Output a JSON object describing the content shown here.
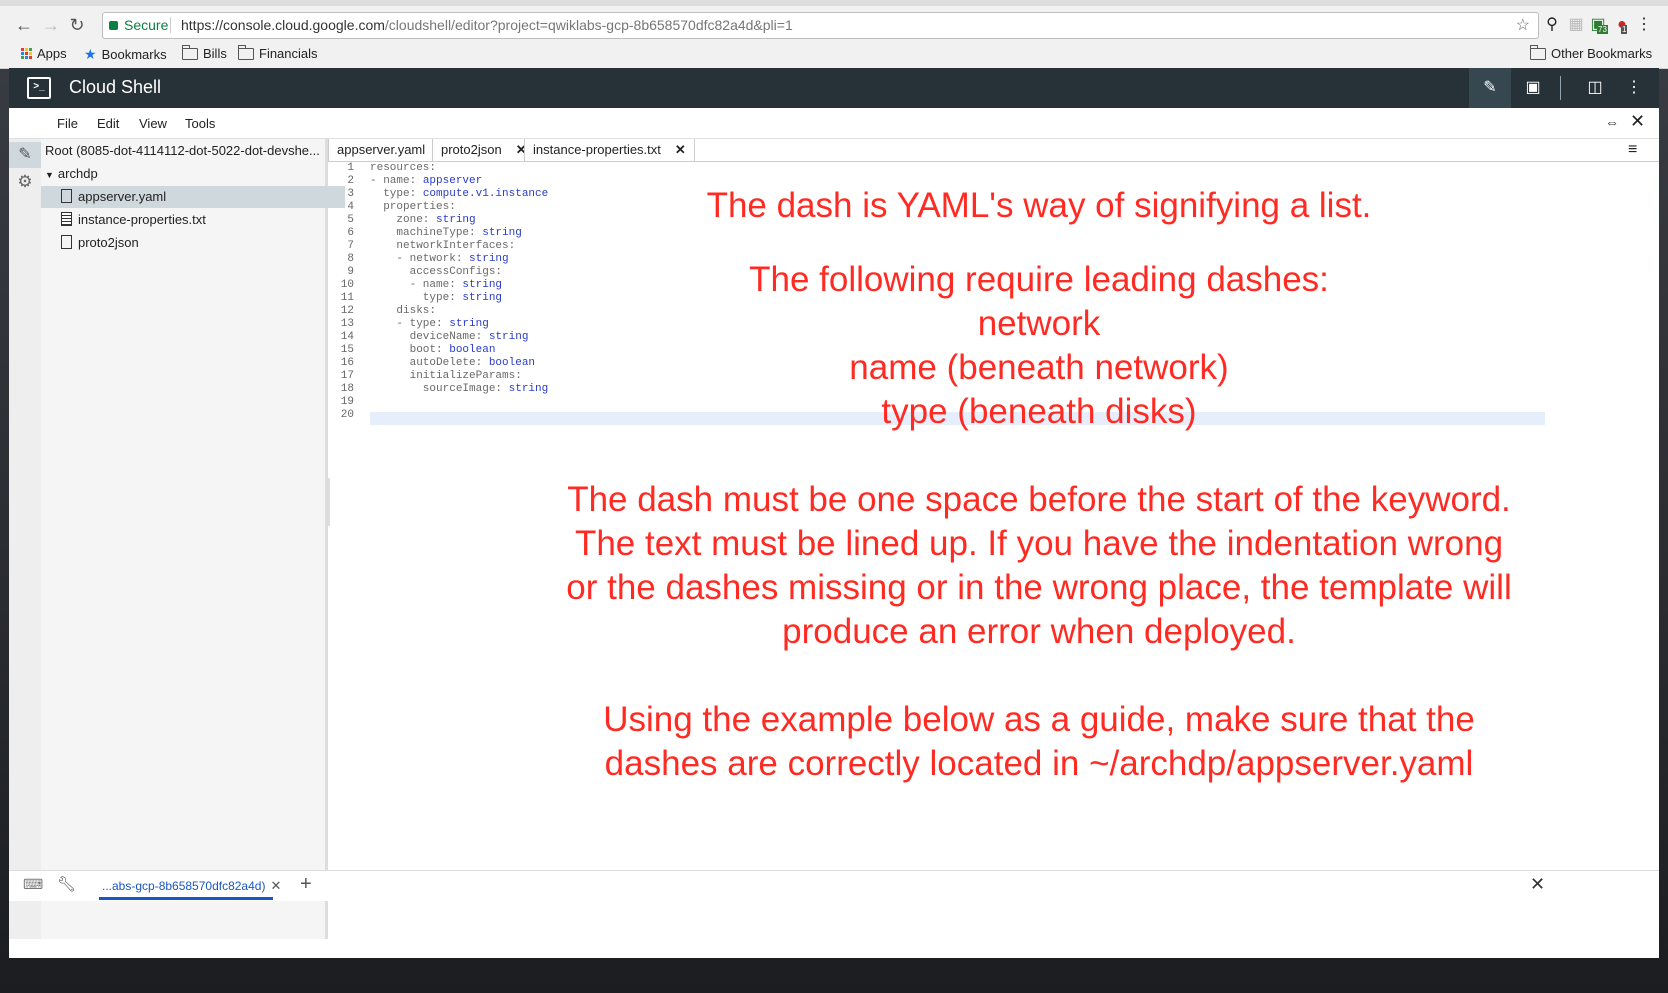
{
  "browser": {
    "secure_label": "Secure",
    "url_host": "https://console.cloud.google.com",
    "url_rest": "/cloudshell/editor?project=qwiklabs-gcp-8b658570dfc82a4d&pli=1",
    "ext_badge_1": "73",
    "ext_badge_2": "1",
    "bookmarks": [
      {
        "label": "Apps",
        "icon": "apps-grid-icon"
      },
      {
        "label": "Bookmarks",
        "icon": "star-icon"
      },
      {
        "label": "Bills",
        "icon": "folder-icon"
      },
      {
        "label": "Financials",
        "icon": "folder-icon"
      }
    ],
    "other_bookmarks": "Other Bookmarks"
  },
  "app": {
    "title": "Cloud Shell",
    "menu": [
      "File",
      "Edit",
      "View",
      "Tools"
    ]
  },
  "tree": {
    "root": "Root (8085-dot-4114112-dot-5022-dot-devshe...",
    "folder": "archdp",
    "files": [
      "appserver.yaml",
      "instance-properties.txt",
      "proto2json"
    ],
    "selected": "appserver.yaml"
  },
  "editor": {
    "tabs": [
      "appserver.yaml",
      "proto2json",
      "instance-properties.txt"
    ],
    "lines": [
      {
        "n": "1",
        "k": "resources:",
        "v": ""
      },
      {
        "n": "2",
        "k": "- name: ",
        "v": "appserver"
      },
      {
        "n": "3",
        "k": "  type: ",
        "v": "compute.v1.instance"
      },
      {
        "n": "4",
        "k": "  properties:",
        "v": ""
      },
      {
        "n": "5",
        "k": "    zone: ",
        "v": "string"
      },
      {
        "n": "6",
        "k": "    machineType: ",
        "v": "string"
      },
      {
        "n": "7",
        "k": "    networkInterfaces:",
        "v": ""
      },
      {
        "n": "8",
        "k": "    - network: ",
        "v": "string"
      },
      {
        "n": "9",
        "k": "      accessConfigs:",
        "v": ""
      },
      {
        "n": "10",
        "k": "      - name: ",
        "v": "string"
      },
      {
        "n": "11",
        "k": "        type: ",
        "v": "string"
      },
      {
        "n": "12",
        "k": "    disks:",
        "v": ""
      },
      {
        "n": "13",
        "k": "    - type: ",
        "v": "string"
      },
      {
        "n": "14",
        "k": "      deviceName: ",
        "v": "string"
      },
      {
        "n": "15",
        "k": "      boot: ",
        "v": "boolean"
      },
      {
        "n": "16",
        "k": "      autoDelete: ",
        "v": "boolean"
      },
      {
        "n": "17",
        "k": "      initializeParams:",
        "v": ""
      },
      {
        "n": "18",
        "k": "        sourceImage: ",
        "v": "string"
      },
      {
        "n": "19",
        "k": "",
        "v": ""
      },
      {
        "n": "20",
        "k": "",
        "v": ""
      }
    ]
  },
  "annotation": {
    "line1": "The dash is YAML's way of signifying a list.",
    "line2": "The following require leading dashes:",
    "line3": "network",
    "line4": "name (beneath network)",
    "line5": "type (beneath disks)",
    "line6": "The dash must be one space before the start of the keyword.",
    "line7": "The text must be lined up. If you have the indentation wrong",
    "line8": "or the dashes missing or in the wrong place, the template will",
    "line9": "produce an error when deployed.",
    "line10": "Using the example below as a guide, make sure that the",
    "line11": "dashes are correctly located in ~/archdp/appserver.yaml"
  },
  "terminal": {
    "tab_label": "...abs-gcp-8b658570dfc82a4d)"
  },
  "colors": {
    "appbar": "#263238",
    "annotation": "#ff2a22",
    "code_value": "#2a3cc9"
  }
}
